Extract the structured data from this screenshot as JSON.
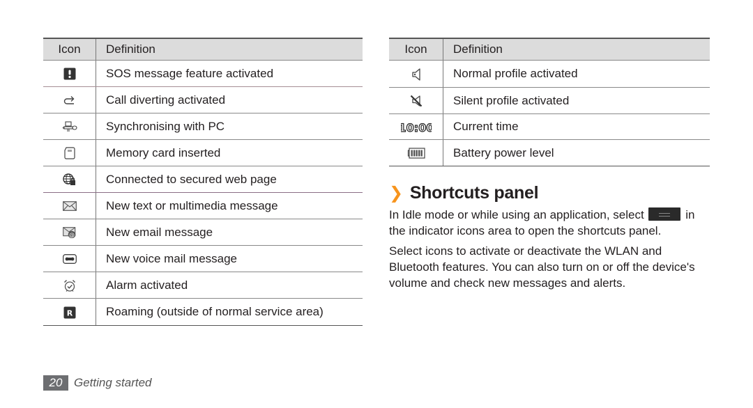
{
  "left_table": {
    "headers": {
      "icon": "Icon",
      "definition": "Definition"
    },
    "rows": [
      {
        "icon": "sos-icon",
        "definition": "SOS message feature activated"
      },
      {
        "icon": "call-divert-icon",
        "definition": "Call diverting activated"
      },
      {
        "icon": "pc-sync-icon",
        "definition": "Synchronising with PC"
      },
      {
        "icon": "memory-card-icon",
        "definition": "Memory card inserted"
      },
      {
        "icon": "secure-web-icon",
        "definition": "Connected to secured web page"
      },
      {
        "icon": "message-envelope-icon",
        "definition": "New text or multimedia message"
      },
      {
        "icon": "email-icon",
        "definition": "New email message"
      },
      {
        "icon": "voicemail-icon",
        "definition": "New voice mail message"
      },
      {
        "icon": "alarm-icon",
        "definition": "Alarm activated"
      },
      {
        "icon": "roaming-icon",
        "definition": "Roaming (outside of normal service area)"
      }
    ]
  },
  "right_table": {
    "headers": {
      "icon": "Icon",
      "definition": "Definition"
    },
    "rows": [
      {
        "icon": "speaker-icon",
        "definition": "Normal profile activated"
      },
      {
        "icon": "speaker-muted-icon",
        "definition": "Silent profile activated"
      },
      {
        "icon": "clock-time-icon",
        "icon_text": "10:00",
        "definition": "Current time"
      },
      {
        "icon": "battery-icon",
        "definition": "Battery power level"
      }
    ]
  },
  "section": {
    "chevron": "❯",
    "title": "Shortcuts panel",
    "para1_before": "In Idle mode or while using an application, select",
    "para1_after": "in the indicator icons area to open the shortcuts panel.",
    "para2": "Select icons to activate or deactivate the WLAN and Bluetooth features. You can also turn on or off the device's volume and check new messages and alerts."
  },
  "footer": {
    "page_number": "20",
    "section_name": "Getting started"
  },
  "colors": {
    "accent": "#f7941d",
    "header_bg": "#dcdcdc",
    "page_badge": "#6d6e71"
  }
}
